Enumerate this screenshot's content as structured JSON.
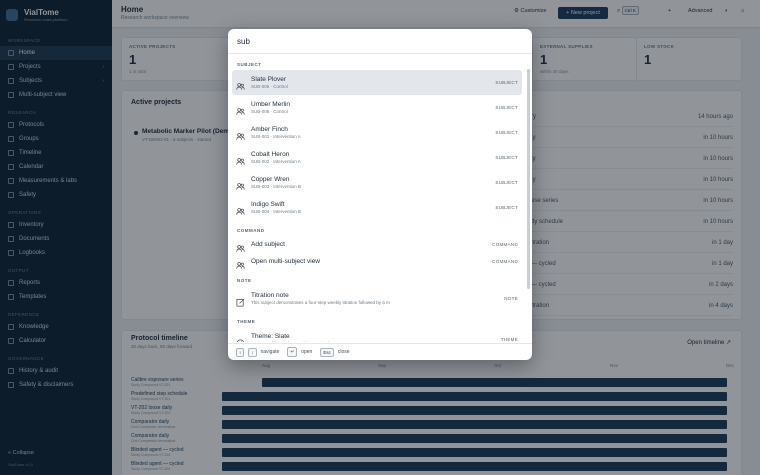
{
  "app": {
    "name": "VialTome",
    "tagline": "Research notes platform"
  },
  "sidebar": {
    "sections": [
      {
        "label": "WORKSPACE",
        "items": [
          {
            "label": "Home",
            "active": true
          },
          {
            "label": "Projects",
            "chevron": "›"
          },
          {
            "label": "Subjects",
            "chevron": "›"
          },
          {
            "label": "Multi-subject view"
          }
        ]
      },
      {
        "label": "RESEARCH",
        "items": [
          {
            "label": "Protocols"
          },
          {
            "label": "Groups"
          },
          {
            "label": "Timeline"
          },
          {
            "label": "Calendar"
          },
          {
            "label": "Measurements & labs"
          },
          {
            "label": "Safety"
          }
        ]
      },
      {
        "label": "OPERATIONS",
        "items": [
          {
            "label": "Inventory"
          },
          {
            "label": "Documents"
          },
          {
            "label": "Logbooks"
          }
        ]
      },
      {
        "label": "OUTPUT",
        "items": [
          {
            "label": "Reports"
          },
          {
            "label": "Templates"
          }
        ]
      },
      {
        "label": "REFERENCE",
        "items": [
          {
            "label": "Knowledge"
          },
          {
            "label": "Calculator"
          }
        ]
      },
      {
        "label": "GOVERNANCE",
        "items": [
          {
            "label": "History & audit"
          },
          {
            "label": "Safety & disclaimers"
          }
        ]
      }
    ],
    "collapse_label": "Collapse",
    "version": "VialTome v1.0"
  },
  "topbar": {
    "title": "Home",
    "subtitle": "Research workspace overview",
    "customize": "Customize",
    "new_project": "+ New project",
    "search_shortcut": "Ctrl K",
    "advanced": "Advanced"
  },
  "kpis": [
    {
      "label": "ACTIVE PROJECTS",
      "value": "1",
      "sub": "1 in total"
    },
    {
      "label": "EXTERNAL SUPPLIES",
      "value": "1",
      "sub": "within 30 days"
    },
    {
      "label": "LOW STOCK",
      "value": "1",
      "sub": ""
    }
  ],
  "active_projects": {
    "title": "Active projects",
    "project_name": "Metabolic Marker Pilot (Dem",
    "project_meta": "VT-DEMO-01 · 6 subjects · started"
  },
  "activity": [
    {
      "label": "ry",
      "time": "14 hours ago"
    },
    {
      "label": "ty",
      "time": "in 10 hours"
    },
    {
      "label": "ty",
      "time": "in 10 hours"
    },
    {
      "label": "ty",
      "time": "in 10 hours"
    },
    {
      "label": "ese series",
      "time": "in 10 hours"
    },
    {
      "label": "dy schedule",
      "time": "in 10 hours"
    },
    {
      "label": "ltration",
      "time": "in 1 day"
    },
    {
      "label": "— cycled",
      "time": "in 1 day"
    },
    {
      "label": "— cycled",
      "time": "in 2 days"
    },
    {
      "label": "ltration",
      "time": "in 4 days"
    }
  ],
  "timeline": {
    "title": "Protocol timeline",
    "subtitle": "30 days back, 90 days forward",
    "open_label": "Open timeline",
    "months": [
      "Aug",
      "Sep",
      "Oct",
      "Nov",
      "Dec"
    ],
    "today_label": "today",
    "rows": [
      {
        "name": "Calibre exposure series",
        "sub": "Study Compound VT-301"
      },
      {
        "name": "Predefined step schedule",
        "sub": "Study Compound VT-301"
      },
      {
        "name": "VT-202 loose daily",
        "sub": "Study Compound VT-202"
      },
      {
        "name": "Comparator daily",
        "sub": "Cmt Comparator demonstrat"
      },
      {
        "name": "Comparator daily",
        "sub": "Cmt Comparator demonstrat"
      },
      {
        "name": "Blinded agent — cycled",
        "sub": "Study Compound VT-204"
      },
      {
        "name": "Blinded agent — cycled",
        "sub": "Study Compound VT-204"
      }
    ]
  },
  "palette": {
    "query": "sub",
    "placeholder": "Search…",
    "groups": [
      {
        "label": "SUBJECT",
        "items": [
          {
            "title": "Slate Plover",
            "sub": "SUB-005 · Control",
            "kind": "SUBJECT",
            "icon": "users-icon",
            "selected": true
          },
          {
            "title": "Umber Merlin",
            "sub": "SUB-006 · Control",
            "kind": "SUBJECT",
            "icon": "users-icon"
          },
          {
            "title": "Amber Finch",
            "sub": "SUB-001 · Intervention A",
            "kind": "SUBJECT",
            "icon": "users-icon"
          },
          {
            "title": "Cobalt Heron",
            "sub": "SUB-002 · Intervention A",
            "kind": "SUBJECT",
            "icon": "users-icon"
          },
          {
            "title": "Copper Wren",
            "sub": "SUB-003 · Intervention B",
            "kind": "SUBJECT",
            "icon": "users-icon"
          },
          {
            "title": "Indigo Swift",
            "sub": "SUB-004 · Intervention B",
            "kind": "SUBJECT",
            "icon": "users-icon"
          }
        ]
      },
      {
        "label": "COMMAND",
        "items": [
          {
            "title": "Add subject",
            "sub": "",
            "kind": "COMMAND",
            "icon": "users-icon"
          },
          {
            "title": "Open multi-subject view",
            "sub": "",
            "kind": "COMMAND",
            "icon": "users-icon"
          }
        ]
      },
      {
        "label": "NOTE",
        "items": [
          {
            "title": "Titration note",
            "sub": "This subject demonstrates a four-step weekly titration followed by a m",
            "kind": "NOTE",
            "icon": "note-icon"
          }
        ]
      },
      {
        "label": "THEME",
        "items": [
          {
            "title": "Theme: Slate",
            "sub": "Cool grey-blue surfaces with restrained contrast.",
            "kind": "THEME",
            "icon": "palette-icon"
          }
        ]
      }
    ],
    "footer": {
      "navigate_keys": [
        "↑",
        "↓"
      ],
      "navigate": "navigate",
      "open_key": "↵",
      "open": "open",
      "close_key": "Esc",
      "close": "close"
    }
  },
  "colors": {
    "sidebar": "#0f2436",
    "accent": "#1a3d5c",
    "bar": "#1e3b58",
    "selection": "#e3e7ec"
  }
}
